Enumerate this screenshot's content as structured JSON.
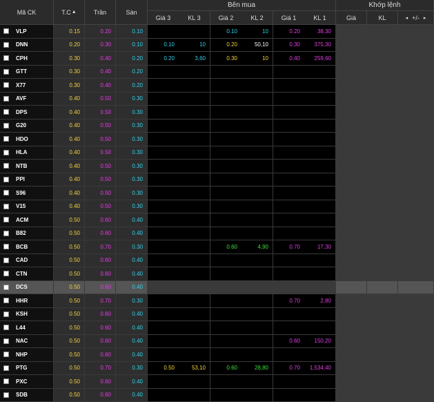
{
  "headers": {
    "symbol": "Mã CK",
    "ref": "T.C",
    "ceiling": "Trần",
    "floor": "Sàn",
    "bid_group": "Bên mua",
    "match_group": "Khớp lệnh",
    "bid_cols": [
      "Giá 3",
      "KL 3",
      "Giá 2",
      "KL 2",
      "Giá 1",
      "KL 1"
    ],
    "match_cols": [
      "Giá",
      "KL",
      "+/-"
    ],
    "sort_icon": "▲",
    "left_arrow": "◂",
    "right_arrow": "▸"
  },
  "colors": {
    "ceiling": "#e040e0",
    "floor": "#2fd0e8",
    "reference": "#f2d33c",
    "up": "#3ce03c"
  },
  "rows": [
    {
      "symbol": "VLP",
      "ref": "0.15",
      "ceiling": "0.20",
      "floor": "0.10",
      "bid": [
        "",
        "",
        "0.10",
        "10",
        "0.20",
        "38,30"
      ],
      "bidColors": [
        "",
        "",
        "cyan",
        "cyan",
        "magenta",
        "magenta"
      ]
    },
    {
      "symbol": "DNN",
      "ref": "0.20",
      "ceiling": "0.30",
      "floor": "0.10",
      "bid": [
        "0.10",
        "10",
        "0.20",
        "50,10",
        "0.30",
        "375,30"
      ],
      "bidColors": [
        "cyan",
        "cyan",
        "yellow",
        "white",
        "magenta",
        "magenta"
      ]
    },
    {
      "symbol": "CPH",
      "ref": "0.30",
      "ceiling": "0.40",
      "floor": "0.20",
      "bid": [
        "0.20",
        "3,60",
        "0.30",
        "10",
        "0.40",
        "259,60"
      ],
      "bidColors": [
        "cyan",
        "cyan",
        "yellow",
        "yellow",
        "magenta",
        "magenta"
      ]
    },
    {
      "symbol": "GTT",
      "ref": "0.30",
      "ceiling": "0.40",
      "floor": "0.20",
      "bid": [
        "",
        "",
        "",
        "",
        "",
        ""
      ],
      "bidColors": [
        "",
        "",
        "",
        "",
        "",
        ""
      ]
    },
    {
      "symbol": "X77",
      "ref": "0.30",
      "ceiling": "0.40",
      "floor": "0.20",
      "bid": [
        "",
        "",
        "",
        "",
        "",
        ""
      ],
      "bidColors": [
        "",
        "",
        "",
        "",
        "",
        ""
      ]
    },
    {
      "symbol": "AVF",
      "ref": "0.40",
      "ceiling": "0.50",
      "floor": "0.30",
      "bid": [
        "",
        "",
        "",
        "",
        "",
        ""
      ],
      "bidColors": [
        "",
        "",
        "",
        "",
        "",
        ""
      ]
    },
    {
      "symbol": "DPS",
      "ref": "0.40",
      "ceiling": "0.50",
      "floor": "0.30",
      "bid": [
        "",
        "",
        "",
        "",
        "",
        ""
      ],
      "bidColors": [
        "",
        "",
        "",
        "",
        "",
        ""
      ]
    },
    {
      "symbol": "G20",
      "ref": "0.40",
      "ceiling": "0.50",
      "floor": "0.30",
      "bid": [
        "",
        "",
        "",
        "",
        "",
        ""
      ],
      "bidColors": [
        "",
        "",
        "",
        "",
        "",
        ""
      ]
    },
    {
      "symbol": "HDO",
      "ref": "0.40",
      "ceiling": "0.50",
      "floor": "0.30",
      "bid": [
        "",
        "",
        "",
        "",
        "",
        ""
      ],
      "bidColors": [
        "",
        "",
        "",
        "",
        "",
        ""
      ]
    },
    {
      "symbol": "HLA",
      "ref": "0.40",
      "ceiling": "0.50",
      "floor": "0.30",
      "bid": [
        "",
        "",
        "",
        "",
        "",
        ""
      ],
      "bidColors": [
        "",
        "",
        "",
        "",
        "",
        ""
      ]
    },
    {
      "symbol": "NTB",
      "ref": "0.40",
      "ceiling": "0.50",
      "floor": "0.30",
      "bid": [
        "",
        "",
        "",
        "",
        "",
        ""
      ],
      "bidColors": [
        "",
        "",
        "",
        "",
        "",
        ""
      ]
    },
    {
      "symbol": "PPI",
      "ref": "0.40",
      "ceiling": "0.50",
      "floor": "0.30",
      "bid": [
        "",
        "",
        "",
        "",
        "",
        ""
      ],
      "bidColors": [
        "",
        "",
        "",
        "",
        "",
        ""
      ]
    },
    {
      "symbol": "S96",
      "ref": "0.40",
      "ceiling": "0.50",
      "floor": "0.30",
      "bid": [
        "",
        "",
        "",
        "",
        "",
        ""
      ],
      "bidColors": [
        "",
        "",
        "",
        "",
        "",
        ""
      ]
    },
    {
      "symbol": "V15",
      "ref": "0.40",
      "ceiling": "0.50",
      "floor": "0.30",
      "bid": [
        "",
        "",
        "",
        "",
        "",
        ""
      ],
      "bidColors": [
        "",
        "",
        "",
        "",
        "",
        ""
      ]
    },
    {
      "symbol": "ACM",
      "ref": "0.50",
      "ceiling": "0.60",
      "floor": "0.40",
      "bid": [
        "",
        "",
        "",
        "",
        "",
        ""
      ],
      "bidColors": [
        "",
        "",
        "",
        "",
        "",
        ""
      ]
    },
    {
      "symbol": "B82",
      "ref": "0.50",
      "ceiling": "0.60",
      "floor": "0.40",
      "bid": [
        "",
        "",
        "",
        "",
        "",
        ""
      ],
      "bidColors": [
        "",
        "",
        "",
        "",
        "",
        ""
      ]
    },
    {
      "symbol": "BCB",
      "ref": "0.50",
      "ceiling": "0.70",
      "floor": "0.30",
      "bid": [
        "",
        "",
        "0.60",
        "4,90",
        "0.70",
        "17,30"
      ],
      "bidColors": [
        "",
        "",
        "green",
        "green",
        "magenta",
        "magenta"
      ]
    },
    {
      "symbol": "CAD",
      "ref": "0.50",
      "ceiling": "0.60",
      "floor": "0.40",
      "bid": [
        "",
        "",
        "",
        "",
        "",
        ""
      ],
      "bidColors": [
        "",
        "",
        "",
        "",
        "",
        ""
      ]
    },
    {
      "symbol": "CTN",
      "ref": "0.50",
      "ceiling": "0.60",
      "floor": "0.40",
      "bid": [
        "",
        "",
        "",
        "",
        "",
        ""
      ],
      "bidColors": [
        "",
        "",
        "",
        "",
        "",
        ""
      ]
    },
    {
      "symbol": "DCS",
      "ref": "0.50",
      "ceiling": "0.60",
      "floor": "0.40",
      "bid": [
        "",
        "",
        "",
        "",
        "",
        ""
      ],
      "bidColors": [
        "",
        "",
        "",
        "",
        "",
        ""
      ],
      "highlight": true
    },
    {
      "symbol": "HHR",
      "ref": "0.50",
      "ceiling": "0.70",
      "floor": "0.30",
      "bid": [
        "",
        "",
        "",
        "",
        "0.70",
        "2,80"
      ],
      "bidColors": [
        "",
        "",
        "",
        "",
        "magenta",
        "magenta"
      ]
    },
    {
      "symbol": "KSH",
      "ref": "0.50",
      "ceiling": "0.60",
      "floor": "0.40",
      "bid": [
        "",
        "",
        "",
        "",
        "",
        ""
      ],
      "bidColors": [
        "",
        "",
        "",
        "",
        "",
        ""
      ]
    },
    {
      "symbol": "L44",
      "ref": "0.50",
      "ceiling": "0.60",
      "floor": "0.40",
      "bid": [
        "",
        "",
        "",
        "",
        "",
        ""
      ],
      "bidColors": [
        "",
        "",
        "",
        "",
        "",
        ""
      ]
    },
    {
      "symbol": "NAC",
      "ref": "0.50",
      "ceiling": "0.60",
      "floor": "0.40",
      "bid": [
        "",
        "",
        "",
        "",
        "0.60",
        "150,20"
      ],
      "bidColors": [
        "",
        "",
        "",
        "",
        "magenta",
        "magenta"
      ]
    },
    {
      "symbol": "NHP",
      "ref": "0.50",
      "ceiling": "0.60",
      "floor": "0.40",
      "bid": [
        "",
        "",
        "",
        "",
        "",
        ""
      ],
      "bidColors": [
        "",
        "",
        "",
        "",
        "",
        ""
      ]
    },
    {
      "symbol": "PTG",
      "ref": "0.50",
      "ceiling": "0.70",
      "floor": "0.30",
      "bid": [
        "0.50",
        "53,10",
        "0.60",
        "28,80",
        "0.70",
        "1,534,40"
      ],
      "bidColors": [
        "yellow",
        "yellow",
        "green",
        "green",
        "magenta",
        "magenta"
      ]
    },
    {
      "symbol": "PXC",
      "ref": "0.50",
      "ceiling": "0.60",
      "floor": "0.40",
      "bid": [
        "",
        "",
        "",
        "",
        "",
        ""
      ],
      "bidColors": [
        "",
        "",
        "",
        "",
        "",
        ""
      ]
    },
    {
      "symbol": "SDB",
      "ref": "0.50",
      "ceiling": "0.60",
      "floor": "0.40",
      "bid": [
        "",
        "",
        "",
        "",
        "",
        ""
      ],
      "bidColors": [
        "",
        "",
        "",
        "",
        "",
        ""
      ]
    }
  ]
}
